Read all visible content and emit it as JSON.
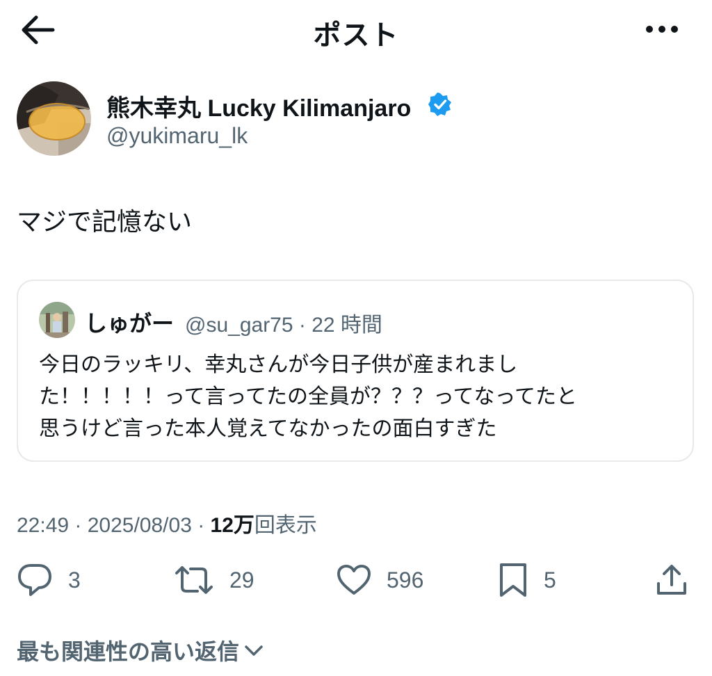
{
  "header": {
    "title": "ポスト",
    "back_icon": "arrow-left-icon",
    "more_icon": "more-horizontal-icon"
  },
  "author": {
    "name": "熊木幸丸 Lucky Kilimanjaro",
    "handle": "@yukimaru_lk",
    "verified_icon": "verified-badge-icon"
  },
  "post": {
    "text": "マジで記憶ない",
    "timestamp": "22:49 · 2025/08/03 · ",
    "views_count": "12万",
    "views_label": "回表示"
  },
  "quote": {
    "name": "しゅがー",
    "meta": "@su_gar75 · 22 時間",
    "lines": [
      "今日のラッキリ、幸丸さんが今日子供が産まれまし",
      "た！！！！！って言ってたの全員が？？？ってなってたと",
      "思うけど言った本人覚えてなかったの面白すぎた"
    ]
  },
  "actions": {
    "replies": "3",
    "reposts": "29",
    "likes": "596",
    "bookmarks": "5",
    "icons": [
      "reply-icon",
      "repost-icon",
      "like-icon",
      "bookmark-icon",
      "share-icon"
    ]
  },
  "sort": {
    "label": "最も関連性の高い返信"
  },
  "colors": {
    "text": "#0f1419",
    "secondary": "#536471",
    "border": "#e7e9ea",
    "verified": "#1d9bf0"
  }
}
